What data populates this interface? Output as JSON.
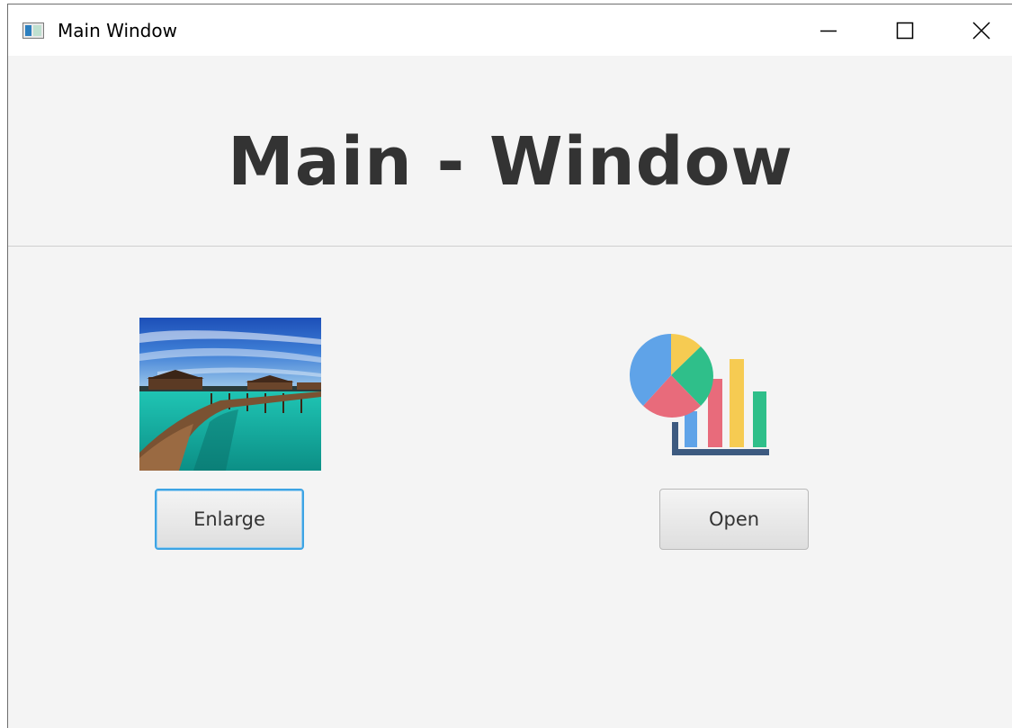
{
  "window": {
    "title": "Main Window",
    "controls": {
      "minimize_icon": "minimize-icon",
      "maximize_icon": "maximize-icon",
      "close_icon": "close-icon"
    }
  },
  "main": {
    "heading": "Main - Window",
    "image_panel": {
      "image": "boardwalk-over-sea-photo",
      "button_label": "Enlarge"
    },
    "chart_panel": {
      "icon": "pie-bar-chart-icon",
      "button_label": "Open"
    }
  },
  "colors": {
    "focus_border": "#3da4e4",
    "heading_text": "#333333",
    "window_bg": "#f4f4f4",
    "chart_blue": "#5fa3e8",
    "chart_yellow": "#f6cb52",
    "chart_green": "#2fbf8a",
    "chart_red": "#e86b7b",
    "chart_axis": "#3d5a80"
  }
}
